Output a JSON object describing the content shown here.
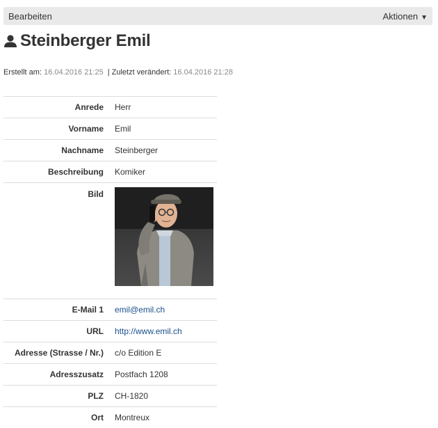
{
  "toolbar": {
    "edit_label": "Bearbeiten",
    "actions_label": "Aktionen",
    "actions_caret": "▼"
  },
  "title": {
    "icon": "user-icon",
    "text": "Steinberger Emil"
  },
  "meta": {
    "created_label": "Erstellt am:",
    "created_value": "16.04.2016 21:25",
    "separator": "|",
    "modified_label": "Zuletzt verändert:",
    "modified_value": "16.04.2016 21:28"
  },
  "fields": {
    "anrede": {
      "label": "Anrede",
      "value": "Herr"
    },
    "vorname": {
      "label": "Vorname",
      "value": "Emil"
    },
    "nachname": {
      "label": "Nachname",
      "value": "Steinberger"
    },
    "beschreibung": {
      "label": "Beschreibung",
      "value": "Komiker"
    },
    "bild": {
      "label": "Bild"
    },
    "email": {
      "label": "E-Mail 1",
      "value": "emil@emil.ch"
    },
    "url": {
      "label": "URL",
      "value": "http://www.emil.ch"
    },
    "adresse": {
      "label": "Adresse (Strasse / Nr.)",
      "value": "c/o Edition E"
    },
    "adresszusatz": {
      "label": "Adresszusatz",
      "value": "Postfach 1208"
    },
    "plz": {
      "label": "PLZ",
      "value": "CH-1820"
    },
    "ort": {
      "label": "Ort",
      "value": "Montreux"
    }
  },
  "colors": {
    "toolbar_bg": "#e9e9e9",
    "link": "#1a4f8b",
    "meta_value": "#888888"
  }
}
